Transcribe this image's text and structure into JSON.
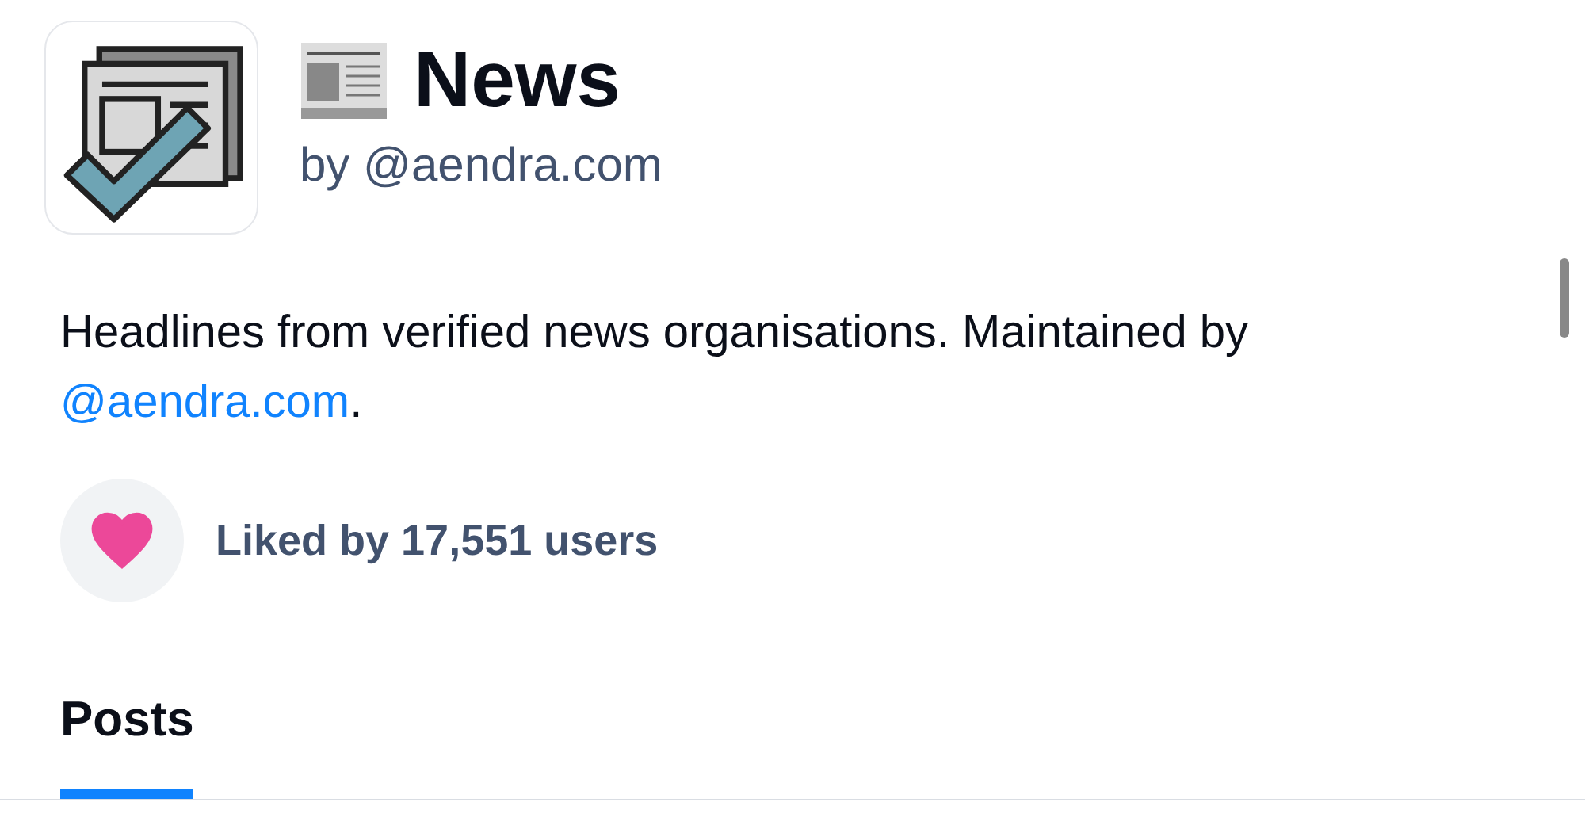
{
  "feed": {
    "title": "News",
    "byline": "by @aendra.com"
  },
  "description": {
    "text": "Headlines from verified news organisations. Maintained by ",
    "link": "@aendra.com",
    "after": "."
  },
  "likes": {
    "label": "Liked by 17,551 users",
    "liked": true
  },
  "tabs": [
    {
      "label": "Posts",
      "selected": true
    }
  ]
}
